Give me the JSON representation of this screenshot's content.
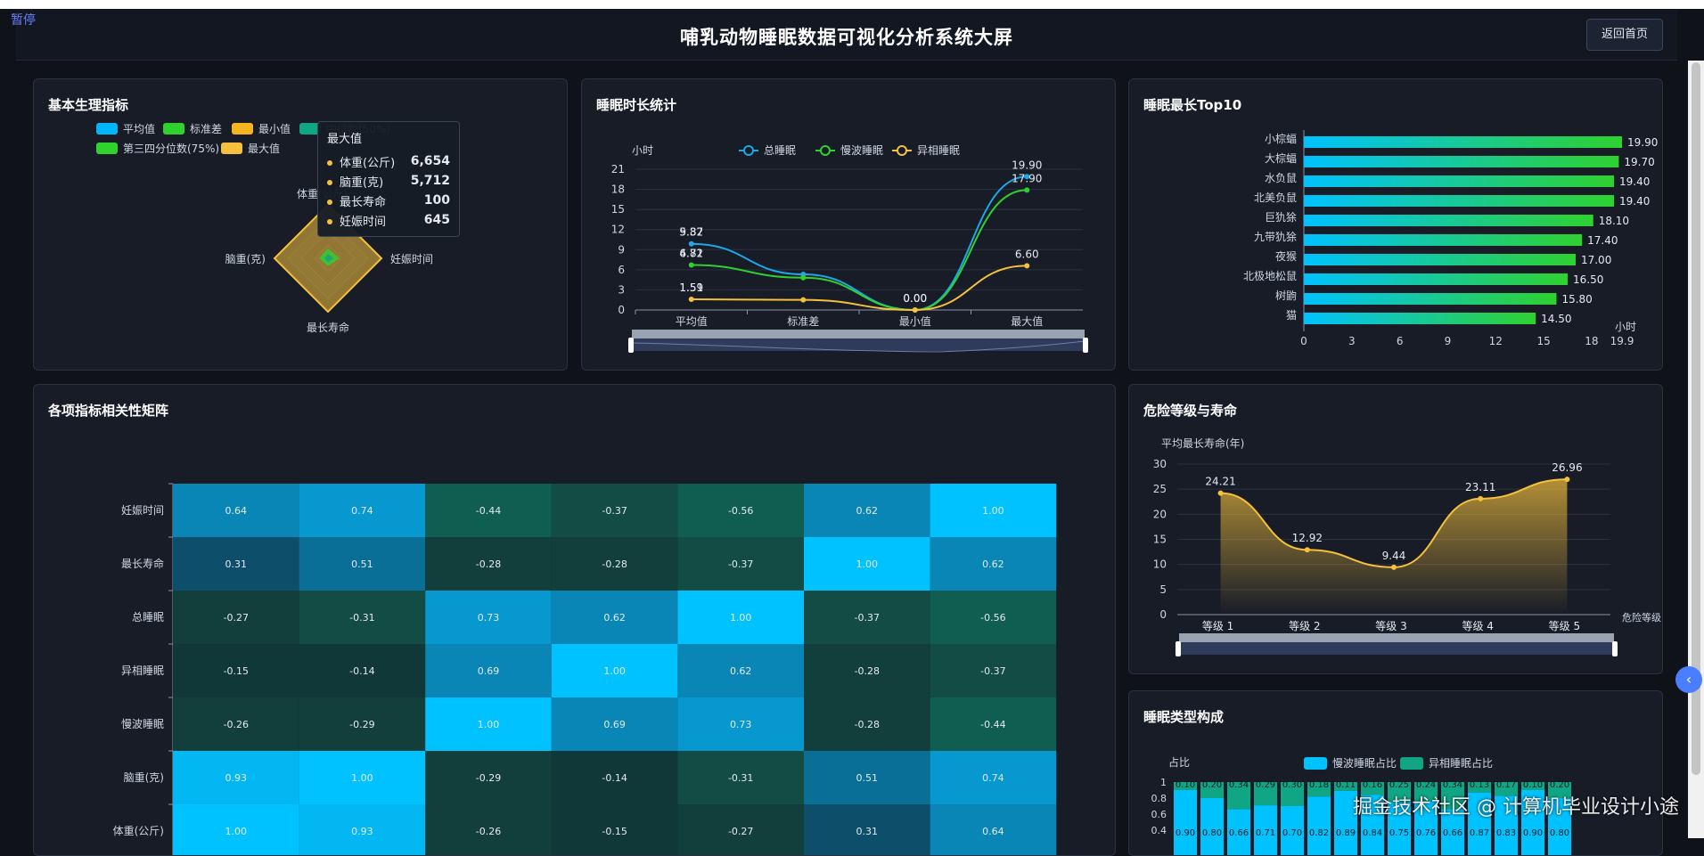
{
  "pause_label": "暂停",
  "header": {
    "title": "哺乳动物睡眠数据可视化分析系统大屏",
    "back_button": "返回首页"
  },
  "watermark": "掘金技术社区 @ 计算机毕业设计小途",
  "colors": {
    "cyan": "#00c2ff",
    "green": "#2fd12f",
    "yellow": "#f5c03c",
    "teal": "#10a685",
    "bg": "#0f1219",
    "panel": "#171c27"
  },
  "panels": {
    "radar": {
      "title": "基本生理指标",
      "legend": [
        {
          "label": "平均值",
          "color": "#00b4ff"
        },
        {
          "label": "标准差",
          "color": "#2fd12f"
        },
        {
          "label": "最小值",
          "color": "#f5b51f"
        },
        {
          "label": "中位数(50%)",
          "color": "#10a685"
        },
        {
          "label": "第三四分位数(75%)",
          "color": "#2fd12f"
        },
        {
          "label": "最大值",
          "color": "#f5c03c"
        }
      ],
      "axes": [
        "体重(公斤)",
        "妊娠时间",
        "最长寿命",
        "脑重(克)"
      ],
      "tooltip": {
        "title": "最大值",
        "rows": [
          {
            "label": "体重(公斤)",
            "value": "6,654"
          },
          {
            "label": "脑重(克)",
            "value": "5,712"
          },
          {
            "label": "最长寿命",
            "value": "100"
          },
          {
            "label": "妊娠时间",
            "value": "645"
          }
        ]
      }
    },
    "sleep_line": {
      "title": "睡眠时长统计"
    },
    "top10": {
      "title": "睡眠最长Top10"
    },
    "heatmap": {
      "title": "各项指标相关性矩阵"
    },
    "danger": {
      "title": "危险等级与寿命"
    },
    "sleep_type": {
      "title": "睡眠类型构成"
    }
  },
  "chart_data": [
    {
      "id": "sleep_line",
      "type": "line",
      "ylabel": "小时",
      "categories": [
        "平均值",
        "标准差",
        "最小值",
        "最大值"
      ],
      "ylim": [
        0,
        21
      ],
      "yticks": [
        0,
        3,
        6,
        9,
        12,
        15,
        18,
        21
      ],
      "series": [
        {
          "name": "总睡眠",
          "color": "#1ea7e8",
          "values": [
            9.87,
            5.32,
            0.0,
            19.9
          ]
        },
        {
          "name": "慢波睡眠",
          "color": "#2fd12f",
          "values": [
            6.71,
            4.82,
            0.0,
            17.9
          ]
        },
        {
          "name": "异相睡眠",
          "color": "#f5c03c",
          "values": [
            1.59,
            1.51,
            0.0,
            6.6
          ]
        }
      ],
      "value_labels": [
        "9.87",
        "6.71",
        "1.59",
        "5.32",
        "4.82",
        "1.51",
        "0.00",
        "0.00",
        "19.90",
        "17.90",
        "6.60"
      ]
    },
    {
      "id": "top10",
      "type": "bar",
      "orientation": "horizontal",
      "xlabel": "小时",
      "xlim": [
        0,
        19.9
      ],
      "xticks": [
        "0",
        "3",
        "6",
        "9",
        "12",
        "15",
        "18",
        "19.9"
      ],
      "categories": [
        "小棕蝠",
        "大棕蝠",
        "水负鼠",
        "北美负鼠",
        "巨犰狳",
        "九带犰狳",
        "夜猴",
        "北极地松鼠",
        "树鼩",
        "猫"
      ],
      "values": [
        19.9,
        19.7,
        19.4,
        19.4,
        18.1,
        17.4,
        17.0,
        16.5,
        15.8,
        14.5
      ],
      "labels": [
        "19.90",
        "19.70",
        "19.40",
        "19.40",
        "18.10",
        "17.40",
        "17.00",
        "16.50",
        "15.80",
        "14.50"
      ]
    },
    {
      "id": "heatmap",
      "type": "heatmap",
      "rows": [
        "妊娠时间",
        "最长寿命",
        "总睡眠",
        "异相睡眠",
        "慢波睡眠",
        "脑重(克)",
        "体重(公斤)"
      ],
      "values": [
        [
          0.64,
          0.74,
          -0.44,
          -0.37,
          -0.56,
          0.62,
          1.0
        ],
        [
          0.31,
          0.51,
          -0.28,
          -0.28,
          -0.37,
          1.0,
          0.62
        ],
        [
          -0.27,
          -0.31,
          0.73,
          0.62,
          1.0,
          -0.37,
          -0.56
        ],
        [
          -0.15,
          -0.14,
          0.69,
          1.0,
          0.62,
          -0.28,
          -0.37
        ],
        [
          -0.26,
          -0.29,
          1.0,
          0.69,
          0.73,
          -0.28,
          -0.44
        ],
        [
          0.93,
          1.0,
          -0.29,
          -0.14,
          -0.31,
          0.51,
          0.74
        ],
        [
          1.0,
          0.93,
          -0.26,
          -0.15,
          -0.27,
          0.31,
          0.64
        ]
      ],
      "labels": [
        [
          "0.64",
          "0.74",
          "-0.44",
          "-0.37",
          "-0.56",
          "0.62",
          "1.00"
        ],
        [
          "0.31",
          "0.51",
          "-0.28",
          "-0.28",
          "-0.37",
          "1.00",
          "0.62"
        ],
        [
          "-0.27",
          "-0.31",
          "0.73",
          "0.62",
          "1.00",
          "-0.37",
          "-0.56"
        ],
        [
          "-0.15",
          "-0.14",
          "0.69",
          "1.00",
          "0.62",
          "-0.28",
          "-0.37"
        ],
        [
          "-0.26",
          "-0.29",
          "1.00",
          "0.69",
          "0.73",
          "-0.28",
          "-0.44"
        ],
        [
          "0.93",
          "1.00",
          "-0.29",
          "-0.14",
          "-0.31",
          "0.51",
          "0.74"
        ],
        [
          "1.00",
          "0.93",
          "-0.26",
          "-0.15",
          "-0.27",
          "0.31",
          "0.64"
        ]
      ]
    },
    {
      "id": "danger",
      "type": "area",
      "ylabel": "平均最长寿命(年)",
      "xlabel": "危险等级",
      "categories": [
        "等级 1",
        "等级 2",
        "等级 3",
        "等级 4",
        "等级 5"
      ],
      "values": [
        24.21,
        12.92,
        9.44,
        23.11,
        26.96
      ],
      "labels": [
        "24.21",
        "12.92",
        "9.44",
        "23.11",
        "26.96"
      ],
      "ylim": [
        0,
        30
      ],
      "yticks": [
        0,
        5,
        10,
        15,
        20,
        25,
        30
      ]
    },
    {
      "id": "sleep_type",
      "type": "bar",
      "stacked": true,
      "ylabel": "占比",
      "yticks": [
        "1",
        "0.8",
        "0.6",
        "0.4"
      ],
      "series": [
        {
          "name": "慢波睡眠占比",
          "color": "#00c2ff"
        },
        {
          "name": "异相睡眠占比",
          "color": "#10a685"
        }
      ],
      "top_labels": [
        "0.10",
        "0.20",
        "0.34",
        "0.29",
        "0.30",
        "0.18",
        "0.11",
        "0.16",
        "0.25",
        "0.24",
        "0.34",
        "0.13",
        "0.17",
        "0.10",
        "0.20"
      ],
      "bottom_labels": [
        "0.90",
        "0.80",
        "0.66",
        "0.71",
        "0.70",
        "0.82",
        "0.89",
        "0.84",
        "0.75",
        "0.76",
        "0.66",
        "0.87",
        "0.83",
        "0.90",
        "0.80"
      ]
    }
  ]
}
